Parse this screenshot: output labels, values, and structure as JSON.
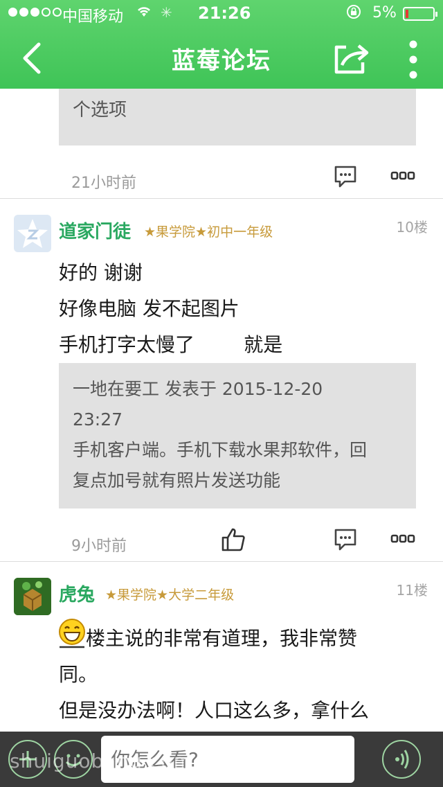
{
  "status_bar": {
    "carrier": "中国移动",
    "time": "21:26",
    "battery": "5%",
    "icons": [
      "wifi-icon",
      "activity-icon",
      "rotation-lock-icon",
      "battery-icon"
    ]
  },
  "nav": {
    "title": "蓝莓论坛",
    "icons": [
      "back-icon",
      "share-icon",
      "more-icon"
    ]
  },
  "colors": {
    "header_green": "#4ccb63",
    "author_green": "#2aa860",
    "rank_gold": "#c79a3a",
    "quote_bg": "#e1e1e1"
  },
  "prev_post": {
    "quote_tail": "个选项",
    "time": "21小时前"
  },
  "posts": [
    {
      "author": "道家门徒",
      "rank": "★果学院★初中一年级",
      "floor": "10楼",
      "lines": [
        "好的 谢谢",
        "好像电脑 发不起图片",
        "手机打字太慢了        就是"
      ],
      "quote": {
        "header": "一地在要工 发表于 2015-12-20",
        "header_time": "23:27",
        "lines": [
          "手机客户端。手机下载水果邦软件，回",
          "复点加号就有照片发送功能"
        ]
      },
      "time": "9小时前"
    },
    {
      "author": "虎兔",
      "rank": "★果学院★大学二年级",
      "floor": "11楼",
      "lines": [
        "楼主说的非常有道理，我非常赞",
        "同。",
        "但是没办法啊！人口这么多，拿什么"
      ]
    }
  ],
  "reply_bar": {
    "placeholder": "你怎么看?",
    "watermark": "shuiguobang.com"
  }
}
